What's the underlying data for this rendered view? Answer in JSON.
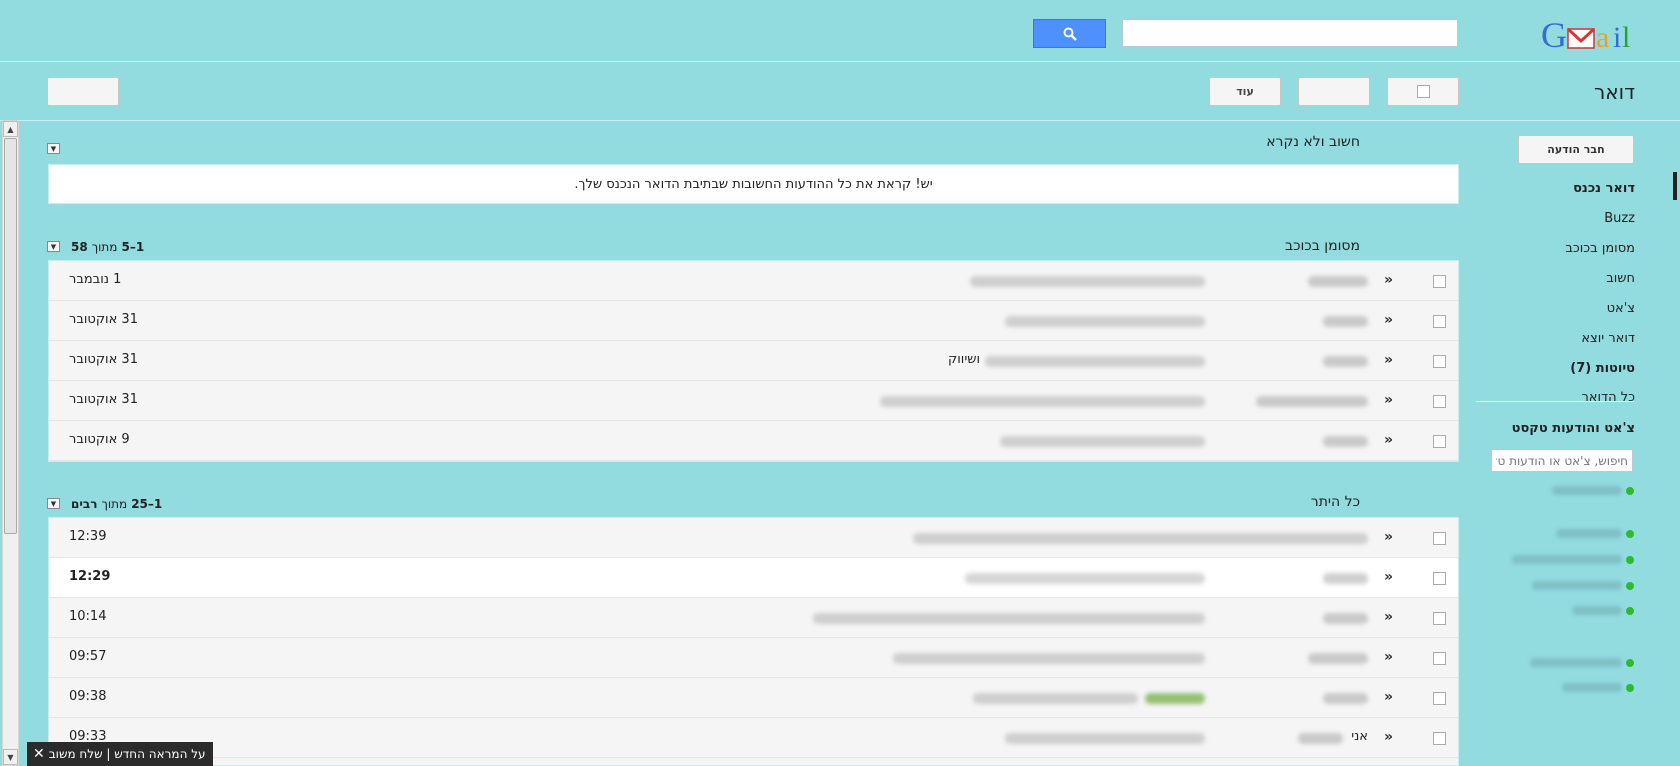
{
  "header": {
    "logo_text": "Gmail",
    "search_value": "",
    "search_icon": "magnifier-icon"
  },
  "toolbar": {
    "title": "דואר",
    "more_label": "עוד"
  },
  "nav": {
    "compose_label": "חבר הודעה",
    "items": [
      {
        "label": "דואר נכנס",
        "bold": true
      },
      {
        "label": "Buzz",
        "bold": false
      },
      {
        "label": "מסומן בכוכב",
        "bold": false
      },
      {
        "label": "חשוב",
        "bold": false
      },
      {
        "label": "צ'אט",
        "bold": false
      },
      {
        "label": "דואר יוצא",
        "bold": false
      },
      {
        "label": "טיוטות (7)",
        "bold": true
      },
      {
        "label": "כל הדואר",
        "bold": false
      }
    ],
    "chat_title": "צ'אט והודעות טקסט",
    "chat_search_placeholder": "חיפוש, צ'אט או הודעות טקסט",
    "presence_color": "#2dbb2d"
  },
  "sections": {
    "important": {
      "title": "חשוב ולא נקרא",
      "notice": "יש! קראת את כל ההודעות החשובות שבתיבת הדואר הנכנס שלך."
    },
    "starred": {
      "title": "מסומן בכוכב",
      "range": "1–5",
      "of_label": "מתוך",
      "total": "58",
      "rows": [
        {
          "date": "1 נובמבר",
          "extra": ""
        },
        {
          "date": "31 אוקטובר",
          "extra": ""
        },
        {
          "date": "31 אוקטובר",
          "extra": "ושיווק"
        },
        {
          "date": "31 אוקטובר",
          "extra": ""
        },
        {
          "date": "9 אוקטובר",
          "extra": ""
        }
      ]
    },
    "everything": {
      "title": "כל היתר",
      "range": "1–25",
      "of_label": "מתוך",
      "total": "רבים",
      "rows": [
        {
          "date": "12:39",
          "unread": false,
          "sender": ""
        },
        {
          "date": "12:29",
          "unread": true,
          "sender": ""
        },
        {
          "date": "10:14",
          "unread": false,
          "sender": ""
        },
        {
          "date": "09:57",
          "unread": false,
          "sender": ""
        },
        {
          "date": "09:38",
          "unread": false,
          "sender": ""
        },
        {
          "date": "09:33",
          "unread": false,
          "sender": "אני"
        }
      ]
    }
  },
  "feedback": {
    "label": "על המראה החדש | שלח משוב",
    "close": "✕"
  }
}
